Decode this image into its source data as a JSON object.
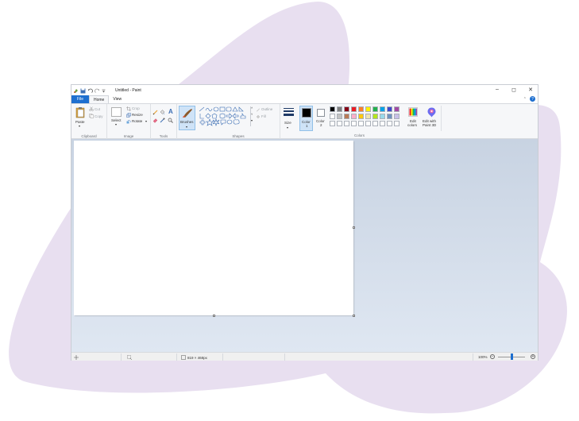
{
  "window": {
    "title": "Untitled - Paint",
    "controls": {
      "minimize": "–",
      "maximize": "◻",
      "close": "✕"
    }
  },
  "menu": {
    "file": "File",
    "home": "Home",
    "view": "View",
    "help": "?"
  },
  "ribbon": {
    "clipboard": {
      "paste": "Paste",
      "cut": "Cut",
      "copy": "Copy",
      "label": "Clipboard"
    },
    "image": {
      "select": "Select",
      "crop": "Crop",
      "resize": "Resize",
      "rotate": "Rotate",
      "label": "Image"
    },
    "tools": {
      "text_glyph": "A",
      "label": "Tools"
    },
    "brushes": {
      "label": "Brushes"
    },
    "shapes": {
      "outline": "Outline",
      "fill": "Fill",
      "label": "Shapes"
    },
    "size": {
      "label": "Size"
    },
    "color1": {
      "label": "Color",
      "num": "1",
      "value": "#000000"
    },
    "color2": {
      "label": "Color",
      "num": "2",
      "value": "#ffffff"
    },
    "colors": {
      "label": "Colors",
      "row1": [
        "#000000",
        "#7f7f7f",
        "#880015",
        "#ed1c24",
        "#ff7f27",
        "#fff200",
        "#22b14c",
        "#00a2e8",
        "#3f48cc",
        "#a349a4"
      ],
      "row2": [
        "#ffffff",
        "#c3c3c3",
        "#b97a57",
        "#ffaec9",
        "#ffc90e",
        "#efe4b0",
        "#b5e61d",
        "#99d9ea",
        "#7092be",
        "#c8bfe7"
      ],
      "row3": [
        "#ffffff",
        "#ffffff",
        "#ffffff",
        "#ffffff",
        "#ffffff",
        "#ffffff",
        "#ffffff",
        "#ffffff",
        "#ffffff",
        "#ffffff"
      ]
    },
    "edit_colors": {
      "line1": "Edit",
      "line2": "colors"
    },
    "edit_3d": {
      "line1": "Edit with",
      "line2": "Paint 3D"
    }
  },
  "statusbar": {
    "dimensions": "819 × 468px",
    "zoom": "100%",
    "zoom_level": 0.5
  }
}
